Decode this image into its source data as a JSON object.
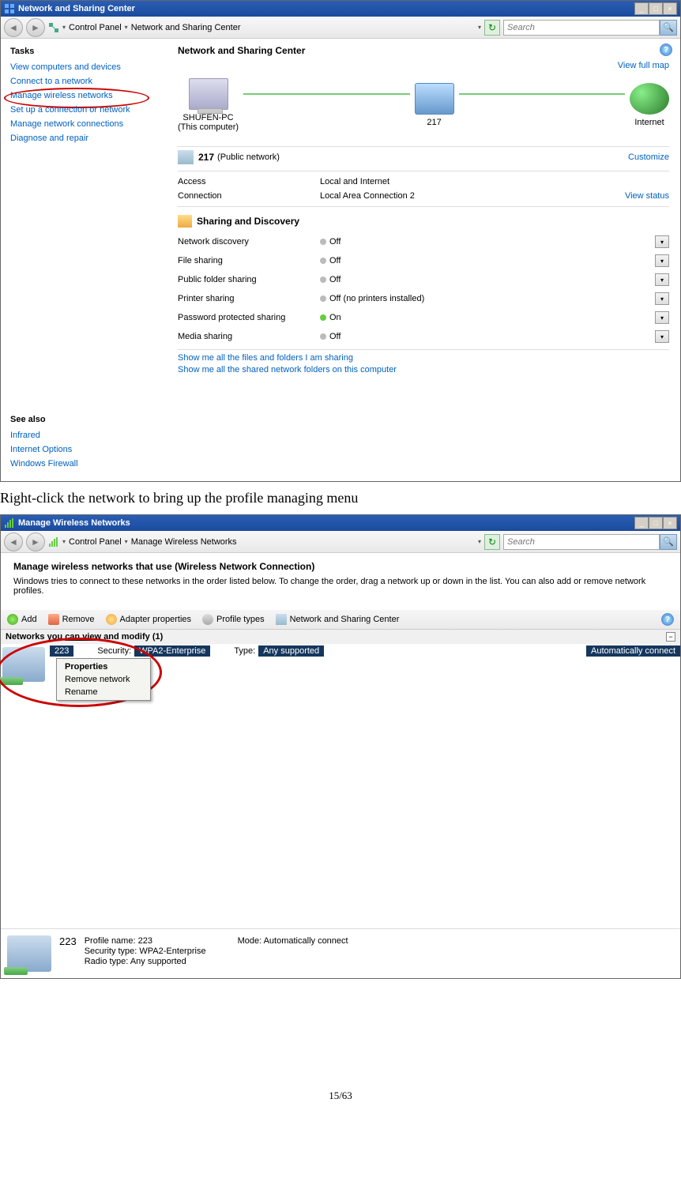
{
  "screenshot1": {
    "title": "Network and Sharing Center",
    "breadcrumb": {
      "root": "Control Panel",
      "leaf": "Network and Sharing Center"
    },
    "search_placeholder": "Search",
    "sidebar": {
      "tasks_heading": "Tasks",
      "links": [
        "View computers and devices",
        "Connect to a network",
        "Manage wireless networks",
        "Set up a connection or network",
        "Manage network connections",
        "Diagnose and repair"
      ],
      "see_also_heading": "See also",
      "see_also": [
        "Infrared",
        "Internet Options",
        "Windows Firewall"
      ]
    },
    "main_heading": "Network and Sharing Center",
    "view_full_map": "View full map",
    "map": {
      "node1": "SHUFEN-PC",
      "node1_sub": "(This computer)",
      "node2": "217",
      "node3": "Internet"
    },
    "network": {
      "name": "217",
      "type": "(Public network)",
      "customize": "Customize",
      "access_label": "Access",
      "access_value": "Local and Internet",
      "conn_label": "Connection",
      "conn_value": "Local Area Connection 2",
      "view_status": "View status"
    },
    "sharing_heading": "Sharing and Discovery",
    "sharing": [
      {
        "label": "Network discovery",
        "value": "Off",
        "on": false
      },
      {
        "label": "File sharing",
        "value": "Off",
        "on": false
      },
      {
        "label": "Public folder sharing",
        "value": "Off",
        "on": false
      },
      {
        "label": "Printer sharing",
        "value": "Off (no printers installed)",
        "on": false
      },
      {
        "label": "Password protected sharing",
        "value": "On",
        "on": true
      },
      {
        "label": "Media sharing",
        "value": "Off",
        "on": false
      }
    ],
    "bottom_links": [
      "Show me all the files and folders I am sharing",
      "Show me all the shared network folders on this computer"
    ]
  },
  "instruction": "Right-click the network to bring up the profile managing menu",
  "screenshot2": {
    "title": "Manage Wireless Networks",
    "breadcrumb": {
      "root": "Control Panel",
      "leaf": "Manage Wireless Networks"
    },
    "search_placeholder": "Search",
    "heading": "Manage wireless networks that use (Wireless Network Connection)",
    "desc": "Windows tries to connect to these networks in the order listed below. To change the order, drag a network up or down in the list. You can also add or remove network profiles.",
    "toolbar": {
      "add": "Add",
      "remove": "Remove",
      "adapter": "Adapter properties",
      "profile": "Profile types",
      "nsc": "Network and Sharing Center"
    },
    "list_header": {
      "prefix": "Networks you ",
      "mid": "can view",
      "suffix": " and modify (1)"
    },
    "row": {
      "name": "223",
      "security_label": "Security:",
      "security_value": "WPA2-Enterprise",
      "type_label": "Type:",
      "type_value": "Any supported",
      "auto": "Automatically connect"
    },
    "context_menu": [
      "Properties",
      "Remove network",
      "Rename"
    ],
    "details": {
      "name": "223",
      "profile_name_label": "Profile name:",
      "profile_name_value": "223",
      "security_label": "Security type:",
      "security_value": "WPA2-Enterprise",
      "radio_label": "Radio type:",
      "radio_value": "Any supported",
      "mode_label": "Mode:",
      "mode_value": "Automatically connect"
    }
  },
  "page_number": "15/63"
}
